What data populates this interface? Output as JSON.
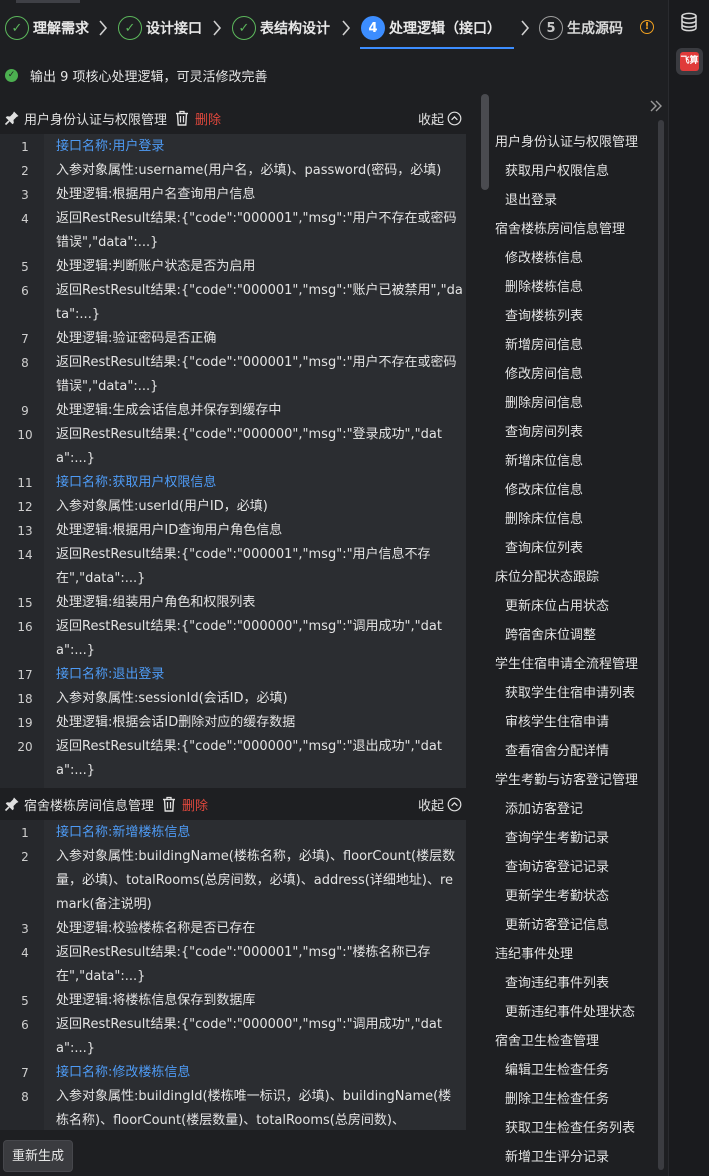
{
  "stepper": {
    "steps": [
      {
        "num": "✓",
        "label": "理解需求",
        "state": "done"
      },
      {
        "num": "✓",
        "label": "设计接口",
        "state": "done"
      },
      {
        "num": "✓",
        "label": "表结构设计",
        "state": "done"
      },
      {
        "num": "4",
        "label": "处理逻辑（接口）",
        "state": "active"
      },
      {
        "num": "5",
        "label": "生成源码",
        "state": "todo"
      }
    ],
    "info_icon": "info-icon"
  },
  "status": {
    "icon": "check-circle-icon",
    "text": "输出 9 项核心处理逻辑，可灵活修改完善"
  },
  "sections": [
    {
      "title": "用户身份认证与权限管理",
      "delete_label": "删除",
      "fold_label": "收起",
      "lines": [
        {
          "n": "1",
          "text": "接口名称:用户登录",
          "kind": "ifc"
        },
        {
          "n": "2",
          "text": "入参对象属性:username(用户名，必填)、password(密码，必填)",
          "kind": "txt"
        },
        {
          "n": "3",
          "text": "处理逻辑:根据用户名查询用户信息",
          "kind": "txt"
        },
        {
          "n": "4",
          "text": "返回RestResult结果:{\"code\":\"000001\",\"msg\":\"用户不存在或密码错误\",\"data\":...}",
          "kind": "txt"
        },
        {
          "n": "5",
          "text": "处理逻辑:判断账户状态是否为启用",
          "kind": "txt"
        },
        {
          "n": "6",
          "text": "返回RestResult结果:{\"code\":\"000001\",\"msg\":\"账户已被禁用\",\"data\":...}",
          "kind": "txt"
        },
        {
          "n": "7",
          "text": "处理逻辑:验证密码是否正确",
          "kind": "txt"
        },
        {
          "n": "8",
          "text": "返回RestResult结果:{\"code\":\"000001\",\"msg\":\"用户不存在或密码错误\",\"data\":...}",
          "kind": "txt"
        },
        {
          "n": "9",
          "text": "处理逻辑:生成会话信息并保存到缓存中",
          "kind": "txt"
        },
        {
          "n": "10",
          "text": "返回RestResult结果:{\"code\":\"000000\",\"msg\":\"登录成功\",\"data\":...}",
          "kind": "txt"
        },
        {
          "n": "11",
          "text": "接口名称:获取用户权限信息",
          "kind": "ifc"
        },
        {
          "n": "12",
          "text": "入参对象属性:userId(用户ID，必填)",
          "kind": "txt"
        },
        {
          "n": "13",
          "text": "处理逻辑:根据用户ID查询用户角色信息",
          "kind": "txt"
        },
        {
          "n": "14",
          "text": "返回RestResult结果:{\"code\":\"000001\",\"msg\":\"用户信息不存在\",\"data\":...}",
          "kind": "txt"
        },
        {
          "n": "15",
          "text": "处理逻辑:组装用户角色和权限列表",
          "kind": "txt"
        },
        {
          "n": "16",
          "text": "返回RestResult结果:{\"code\":\"000000\",\"msg\":\"调用成功\",\"data\":...}",
          "kind": "txt"
        },
        {
          "n": "17",
          "text": "接口名称:退出登录",
          "kind": "ifc"
        },
        {
          "n": "18",
          "text": "入参对象属性:sessionId(会话ID，必填)",
          "kind": "txt"
        },
        {
          "n": "19",
          "text": "处理逻辑:根据会话ID删除对应的缓存数据",
          "kind": "txt"
        },
        {
          "n": "20",
          "text": "返回RestResult结果:{\"code\":\"000000\",\"msg\":\"退出成功\",\"data\":...}",
          "kind": "txt"
        }
      ]
    },
    {
      "title": "宿舍楼栋房间信息管理",
      "delete_label": "删除",
      "fold_label": "收起",
      "lines": [
        {
          "n": "1",
          "text": "接口名称:新增楼栋信息",
          "kind": "ifc"
        },
        {
          "n": "2",
          "text": "入参对象属性:buildingName(楼栋名称，必填)、floorCount(楼层数量，必填)、totalRooms(总房间数，必填)、address(详细地址)、remark(备注说明)",
          "kind": "txt"
        },
        {
          "n": "3",
          "text": "处理逻辑:校验楼栋名称是否已存在",
          "kind": "txt"
        },
        {
          "n": "4",
          "text": "返回RestResult结果:{\"code\":\"000001\",\"msg\":\"楼栋名称已存在\",\"data\":...}",
          "kind": "txt"
        },
        {
          "n": "5",
          "text": "处理逻辑:将楼栋信息保存到数据库",
          "kind": "txt"
        },
        {
          "n": "6",
          "text": "返回RestResult结果:{\"code\":\"000000\",\"msg\":\"调用成功\",\"data\":...}",
          "kind": "txt"
        },
        {
          "n": "7",
          "text": "接口名称:修改楼栋信息",
          "kind": "ifc"
        },
        {
          "n": "8",
          "text": "入参对象属性:buildingId(楼栋唯一标识，必填)、buildingName(楼栋名称)、floorCount(楼层数量)、totalRooms(总房间数)、",
          "kind": "txt"
        }
      ]
    }
  ],
  "outline": {
    "items": [
      {
        "text": "用户身份认证与权限管理",
        "level": "grp"
      },
      {
        "text": "获取用户权限信息",
        "level": "sub"
      },
      {
        "text": "退出登录",
        "level": "sub"
      },
      {
        "text": "宿舍楼栋房间信息管理",
        "level": "grp"
      },
      {
        "text": "修改楼栋信息",
        "level": "sub"
      },
      {
        "text": "删除楼栋信息",
        "level": "sub"
      },
      {
        "text": "查询楼栋列表",
        "level": "sub"
      },
      {
        "text": "新增房间信息",
        "level": "sub"
      },
      {
        "text": "修改房间信息",
        "level": "sub"
      },
      {
        "text": "删除房间信息",
        "level": "sub"
      },
      {
        "text": "查询房间列表",
        "level": "sub"
      },
      {
        "text": "新增床位信息",
        "level": "sub"
      },
      {
        "text": "修改床位信息",
        "level": "sub"
      },
      {
        "text": "删除床位信息",
        "level": "sub"
      },
      {
        "text": "查询床位列表",
        "level": "sub"
      },
      {
        "text": "床位分配状态跟踪",
        "level": "grp"
      },
      {
        "text": "更新床位占用状态",
        "level": "sub"
      },
      {
        "text": "跨宿舍床位调整",
        "level": "sub"
      },
      {
        "text": "学生住宿申请全流程管理",
        "level": "grp"
      },
      {
        "text": "获取学生住宿申请列表",
        "level": "sub"
      },
      {
        "text": "审核学生住宿申请",
        "level": "sub"
      },
      {
        "text": "查看宿舍分配详情",
        "level": "sub"
      },
      {
        "text": "学生考勤与访客登记管理",
        "level": "grp"
      },
      {
        "text": "添加访客登记",
        "level": "sub"
      },
      {
        "text": "查询学生考勤记录",
        "level": "sub"
      },
      {
        "text": "查询访客登记记录",
        "level": "sub"
      },
      {
        "text": "更新学生考勤状态",
        "level": "sub"
      },
      {
        "text": "更新访客登记信息",
        "level": "sub"
      },
      {
        "text": "违纪事件处理",
        "level": "grp"
      },
      {
        "text": "查询违纪事件列表",
        "level": "sub"
      },
      {
        "text": "更新违纪事件处理状态",
        "level": "sub"
      },
      {
        "text": "宿舍卫生检查管理",
        "level": "grp"
      },
      {
        "text": "编辑卫生检查任务",
        "level": "sub"
      },
      {
        "text": "删除卫生检查任务",
        "level": "sub"
      },
      {
        "text": "获取卫生检查任务列表",
        "level": "sub"
      },
      {
        "text": "新增卫生评分记录",
        "level": "sub"
      }
    ]
  },
  "toolbar": {
    "regenerate_label": "重新生成",
    "database_icon": "database-icon",
    "feijiang_badge": "飞算"
  },
  "colors": {
    "background": "#1e1f22",
    "code_bg": "#2b2d31",
    "accent": "#3c8dff",
    "success": "#5cb85c",
    "danger": "#e0483d",
    "interface_text": "#4e9bf5",
    "warning": "#f0a020"
  }
}
